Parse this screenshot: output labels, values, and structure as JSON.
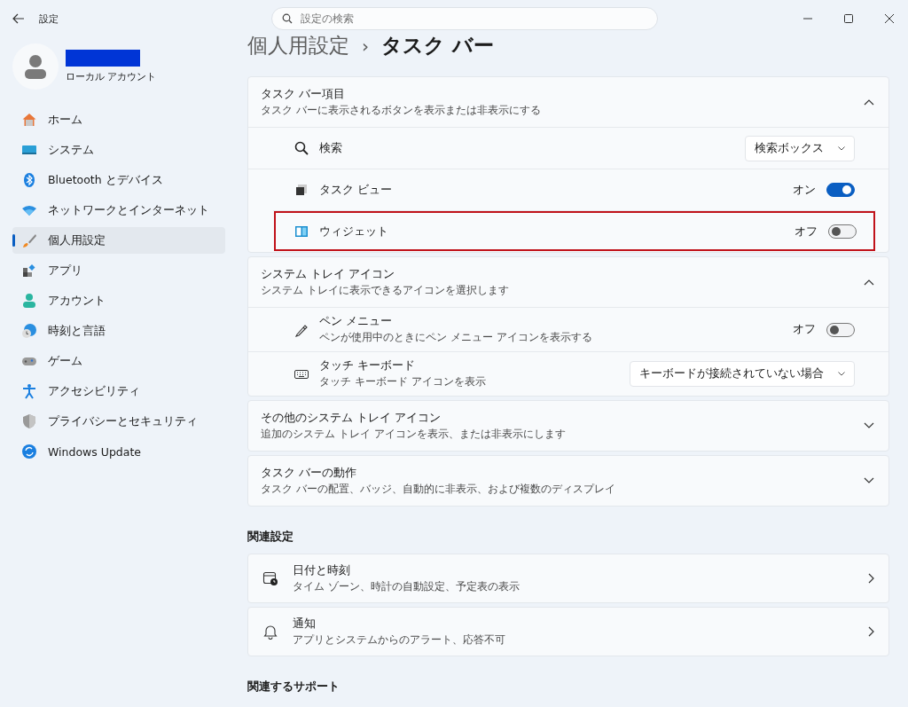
{
  "window": {
    "title": "設定"
  },
  "search": {
    "placeholder": "設定の検索"
  },
  "account": {
    "type": "ローカル アカウント"
  },
  "sidebar": {
    "items": [
      {
        "label": "ホーム",
        "selected": false
      },
      {
        "label": "システム",
        "selected": false
      },
      {
        "label": "Bluetooth とデバイス",
        "selected": false
      },
      {
        "label": "ネットワークとインターネット",
        "selected": false
      },
      {
        "label": "個人用設定",
        "selected": true
      },
      {
        "label": "アプリ",
        "selected": false
      },
      {
        "label": "アカウント",
        "selected": false
      },
      {
        "label": "時刻と言語",
        "selected": false
      },
      {
        "label": "ゲーム",
        "selected": false
      },
      {
        "label": "アクセシビリティ",
        "selected": false
      },
      {
        "label": "プライバシーとセキュリティ",
        "selected": false
      },
      {
        "label": "Windows Update",
        "selected": false
      }
    ]
  },
  "breadcrumb": {
    "parent": "個人用設定",
    "separator": "›",
    "current": "タスク バー"
  },
  "sections": [
    {
      "title": "タスク バー項目",
      "subtitle": "タスク バーに表示されるボタンを表示または非表示にする",
      "expanded": true,
      "items": [
        {
          "kind": "dropdown",
          "label": "検索",
          "value": "検索ボックス",
          "highlighted": false
        },
        {
          "kind": "toggle",
          "label": "タスク ビュー",
          "on": true,
          "state_text": "オン",
          "highlighted": false
        },
        {
          "kind": "toggle",
          "label": "ウィジェット",
          "on": false,
          "state_text": "オフ",
          "highlighted": true
        }
      ]
    },
    {
      "title": "システム トレイ アイコン",
      "subtitle": "システム トレイに表示できるアイコンを選択します",
      "expanded": true,
      "items": [
        {
          "kind": "toggle",
          "label": "ペン メニュー",
          "description": "ペンが使用中のときにペン メニュー アイコンを表示する",
          "on": false,
          "state_text": "オフ",
          "highlighted": false
        },
        {
          "kind": "dropdown",
          "label": "タッチ キーボード",
          "description": "タッチ キーボード アイコンを表示",
          "value": "キーボードが接続されていない場合",
          "highlighted": false
        }
      ]
    },
    {
      "title": "その他のシステム トレイ アイコン",
      "subtitle": "追加のシステム トレイ アイコンを表示、または非表示にします",
      "expanded": false
    },
    {
      "title": "タスク バーの動作",
      "subtitle": "タスク バーの配置、バッジ、自動的に非表示、および複数のディスプレイ",
      "expanded": false
    }
  ],
  "related": {
    "heading": "関連設定",
    "links": [
      {
        "title": "日付と時刻",
        "subtitle": "タイム ゾーン、時計の自動設定、予定表の表示"
      },
      {
        "title": "通知",
        "subtitle": "アプリとシステムからのアラート、応答不可"
      }
    ]
  },
  "support": {
    "heading": "関連するサポート"
  }
}
